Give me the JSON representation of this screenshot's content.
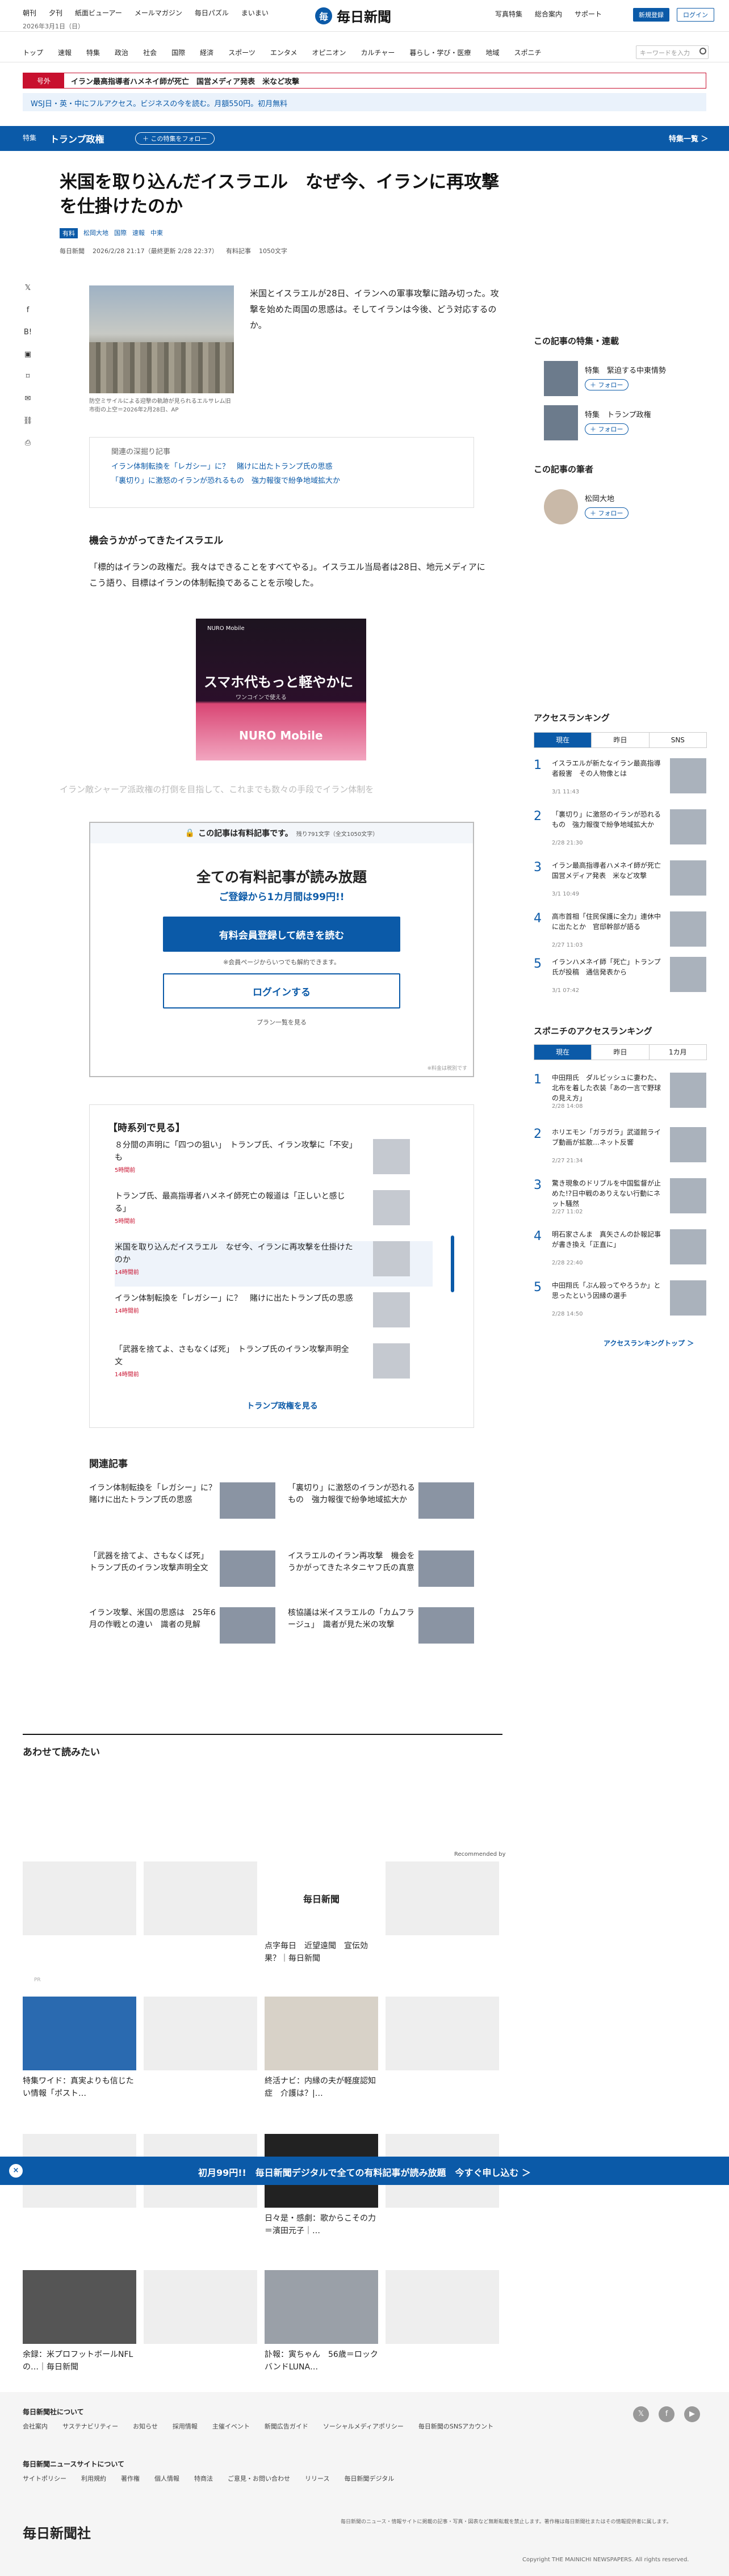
{
  "header": {
    "links": [
      "朝刊",
      "夕刊",
      "紙面ビューアー",
      "メールマガジン",
      "毎日パズル",
      "まいまい"
    ],
    "date": "2026年3月1日（日）",
    "logo_text": "毎日新聞",
    "right_links": [
      "写真特集",
      "総合案内",
      "サポート"
    ],
    "register_label": "新規登録",
    "login_label": "ログイン"
  },
  "nav": {
    "items": [
      "トップ",
      "速報",
      "特集",
      "政治",
      "社会",
      "国際",
      "経済",
      "スポーツ",
      "エンタメ",
      "オピニオン",
      "カルチャー",
      "暮らし・学び・医療",
      "地域",
      "スポニチ"
    ],
    "search_placeholder": "キーワードを入力"
  },
  "breaking": {
    "tag": "号外",
    "text": "イラン最高指導者ハメネイ師が死亡　国営メディア発表　米など攻撃"
  },
  "promo": {
    "text": "WSJ日・英・中にフルアクセス。ビジネスの今を読む。月額550円。初月無料"
  },
  "special": {
    "label": "特集",
    "title": "トランプ政権",
    "follow": "＋ この特集をフォロー",
    "all": "特集一覧 ＞"
  },
  "article": {
    "title": "米国を取り込んだイスラエル　なぜ今、イランに再攻撃を仕掛けたのか",
    "tags": [
      "有料",
      "松岡大地",
      "国際",
      "速報",
      "中東"
    ],
    "source": "毎日新聞",
    "datetime": "2026/2/28 21:17（最終更新 2/28 22:37）",
    "paid_label": "有料記事",
    "chars": "1050文字",
    "lead": "米国とイスラエルが28日、イランへの軍事攻撃に踏み切った。攻撃を始めた両国の思惑は。そしてイランは今後、どう対応するのか。",
    "caption": "防空ミサイルによる迎撃の軌跡が見られるエルサレム旧市街の上空＝2026年2月28日、AP",
    "deep_head": "関連の深掘り記事",
    "deep_links": [
      "イラン体制転換を「レガシー」に？　賭けに出たトランプ氏の思惑",
      "「裏切り」に激怒のイランが恐れるもの　強力報復で紛争地域拡大か"
    ],
    "subhead": "機会うかがってきたイスラエル",
    "para": "「標的はイランの政権だ。我々はできることをすべてやる」。イスラエル当局者は28日、地元メディアにこう語り、目標はイランの体制転換であることを示唆した。",
    "faded": "イラン敵シャーア派政権の打倒を目指して、これまでも数々の手段でイラン体制を"
  },
  "ad": {
    "brand": "NURO Mobile",
    "headline": "スマホ代もっと軽やかに",
    "sub": "ワンコインで使える",
    "logo": "NURO Mobile"
  },
  "paywall": {
    "head": "この記事は有料記事です。",
    "remain": "残り791文字（全文1050文字）",
    "title": "全ての有料記事が読み放題",
    "sub": "ご登録から1カ月間は99円!!",
    "register": "有料会員登録して続きを読む",
    "note": "※会員ページからいつでも解約できます。",
    "login": "ログインする",
    "plan": "プラン一覧を見る",
    "foot": "※料金は税別です"
  },
  "series": {
    "head": "【時系列で見る】",
    "items": [
      {
        "q": "８分間の声明に「四つの狙い」　トランプ氏、イラン攻撃に「不安」も",
        "d": "5時間前"
      },
      {
        "q": "トランプ氏、最高指導者ハメネイ師死亡の報道は「正しいと感じる」",
        "d": "5時間前"
      },
      {
        "q": "米国を取り込んだイスラエル　なぜ今、イランに再攻撃を仕掛けたのか",
        "d": "14時間前"
      },
      {
        "q": "イラン体制転換を「レガシー」に？　賭けに出たトランプ氏の思惑",
        "d": "14時間前"
      },
      {
        "q": "「武器を捨てよ、さもなくば死」　トランプ氏のイラン攻撃声明全文",
        "d": "14時間前"
      }
    ],
    "more": "トランプ政権を見る"
  },
  "related": {
    "head": "関連記事",
    "items": [
      "イラン体制転換を「レガシー」に？　賭けに出たトランプ氏の思惑",
      "「裏切り」に激怒のイランが恐れるもの　強力報復で紛争地域拡大か",
      "「武器を捨てよ、さもなくば死」　トランプ氏のイラン攻撃声明全文",
      "イスラエルのイラン再攻撃　機会をうかがってきたネタニヤフ氏の真意",
      "イラン攻撃、米国の思惑は　25年6月の作戦との違い　識者の見解",
      "核協議は米イスラエルの「カムフラージュ」　識者が見た米の攻撃"
    ]
  },
  "recommend": {
    "head": "あわせて読みたい",
    "badge": "Recommended by",
    "tiles": [
      "点字毎日　近望遠聞　宣伝効果？｜毎日新聞",
      "特集ワイド：真実よりも信じたい情報「ポスト…",
      "終活ナビ：内縁の夫が軽度認知症　介護は？|…",
      "日々是・感劇：歌からこその力＝濱田元子｜…",
      "余録：米プロフットボールNFLの…｜毎日新聞",
      "訃報：寅ちゃん　56歳＝ロックバンドLUNA…"
    ],
    "pr": "PR"
  },
  "sticky": {
    "text": "初月99円!!　毎日新聞デジタルで全ての有料記事が読み放題　今すぐ申し込む ＞"
  },
  "sidebar": {
    "feature_head": "この記事の特集・連載",
    "features": [
      {
        "label": "特集　緊迫する中東情勢",
        "follow": "＋ フォロー"
      },
      {
        "label": "特集　トランプ政権",
        "follow": "＋ フォロー"
      }
    ],
    "author_head": "この記事の筆者",
    "author": {
      "name": "松岡大地",
      "follow": "＋ フォロー"
    },
    "ranking_head": "アクセスランキング",
    "ranking_tabs": [
      "現在",
      "昨日",
      "SNS"
    ],
    "ranking": [
      {
        "q": "イスラエルが新たなイラン最高指導者殺害　その人物像とは",
        "d": "3/1 11:43"
      },
      {
        "q": "「裏切り」に激怒のイランが恐れるもの　強力報復で紛争地域拡大か",
        "d": "2/28 21:30"
      },
      {
        "q": "イラン最高指導者ハメネイ師が死亡　国営メディア発表　米など攻撃",
        "d": "3/1 10:49"
      },
      {
        "q": "高市首相「住民保護に全力」連休中に出たとか　官邸幹部が語る",
        "d": "2/27 11:03"
      },
      {
        "q": "イランハメネイ師「死亡」トランプ氏が投稿　通信発表から",
        "d": "3/1 07:42"
      }
    ],
    "sponichi_head": "スポニチのアクセスランキング",
    "sponichi_tabs": [
      "現在",
      "昨日",
      "1カ月"
    ],
    "sponichi": [
      {
        "q": "中田翔氏　ダルビッシュに妻わた、北布を着した衣装「あの一言で野球の見え方」",
        "d": "2/28 14:08"
      },
      {
        "q": "ホリエモン「ガラガラ」武道館ライブ動画が拡散…ネット反響",
        "d": "2/27 21:34"
      },
      {
        "q": "驚き現象のドリブルを中国監督が止めた!?日中戦のありえない行動にネット騒然",
        "d": "2/27 11:02"
      },
      {
        "q": "明石家さんま　真矢さんの訃報記事が書き換え「正直に」",
        "d": "2/28 22:40"
      },
      {
        "q": "中田翔氏「ぶん殴ってやろうか」と思ったという因縁の選手",
        "d": "2/28 14:50"
      }
    ],
    "sponichi_link": "アクセスランキングトップ ＞"
  },
  "footer": {
    "about_head": "毎日新聞社について",
    "about_links": [
      "会社案内",
      "サステナビリティー",
      "お知らせ",
      "採用情報",
      "主催イベント",
      "新聞広告ガイド",
      "ソーシャルメディアポリシー",
      "毎日新聞のSNSアカウント"
    ],
    "site_head": "毎日新聞ニュースサイトについて",
    "site_links": [
      "サイトポリシー",
      "利用規約",
      "著作権",
      "個人情報",
      "特商法",
      "ご意見・お問い合わせ",
      "リリース",
      "毎日新聞デジタル"
    ],
    "logo": "毎日新聞社",
    "note": "毎日新聞のニュース・情報サイトに掲載の記事・写真・図表など無断転載を禁止します。著作権は毎日新聞社またはその情報提供者に属します。",
    "copy": "Copyright THE MAINICHI NEWSPAPERS. All rights reserved."
  }
}
